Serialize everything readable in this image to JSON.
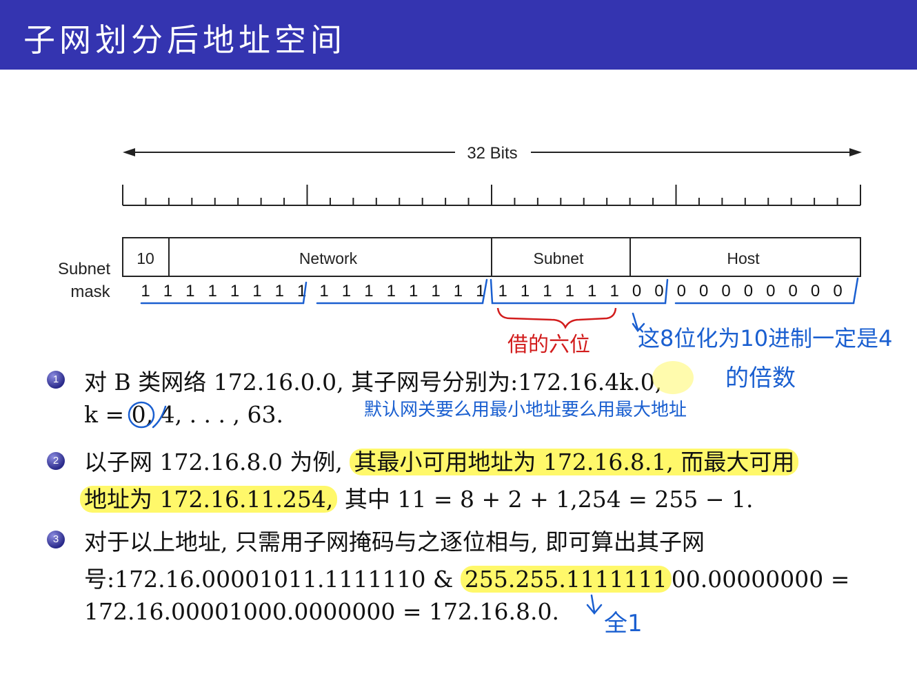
{
  "title": "子网划分后地址空间",
  "diagram": {
    "bits_label": "32 Bits",
    "fields": [
      "10",
      "Network",
      "Subnet",
      "Host"
    ],
    "mask_label_1": "Subnet",
    "mask_label_2": "mask",
    "mask_bits": [
      1,
      1,
      1,
      1,
      1,
      1,
      1,
      1,
      1,
      1,
      1,
      1,
      1,
      1,
      1,
      1,
      1,
      1,
      1,
      1,
      1,
      1,
      0,
      0,
      0,
      0,
      0,
      0,
      0,
      0,
      0,
      0
    ]
  },
  "annotations": {
    "red_note": "借的六位",
    "blue_note_1": "这8位化为10进制一定是4",
    "blue_note_2": "的倍数",
    "blue_note_3": "默认网关要么用最小地址要么用最大地址",
    "blue_note_4": "全1"
  },
  "items": [
    {
      "num": "1",
      "lines": [
        "对 B 类网络 172.16.0.0, 其子网号分别为:172.16.4k.0,",
        "k = 0, 4, . . . , 63."
      ]
    },
    {
      "num": "2",
      "line1_a": "以子网 172.16.8.0 为例, ",
      "line1_hl": "其最小可用地址为 172.16.8.1, 而最大可用",
      "line2_hl": "地址为 172.16.11.254,",
      "line2_b": " 其中 11 = 8 + 2 + 1,254 = 255 − 1."
    },
    {
      "num": "3",
      "line1": "对于以上地址, 只需用子网掩码与之逐位相与, 即可算出其子网",
      "line2_a": "号:172.16.00001011.1111110 & ",
      "line2_hl": "255.255.1111111",
      "line2_b": "00.00000000 =",
      "line3": "172.16.00001000.0000000 = 172.16.8.0."
    }
  ]
}
